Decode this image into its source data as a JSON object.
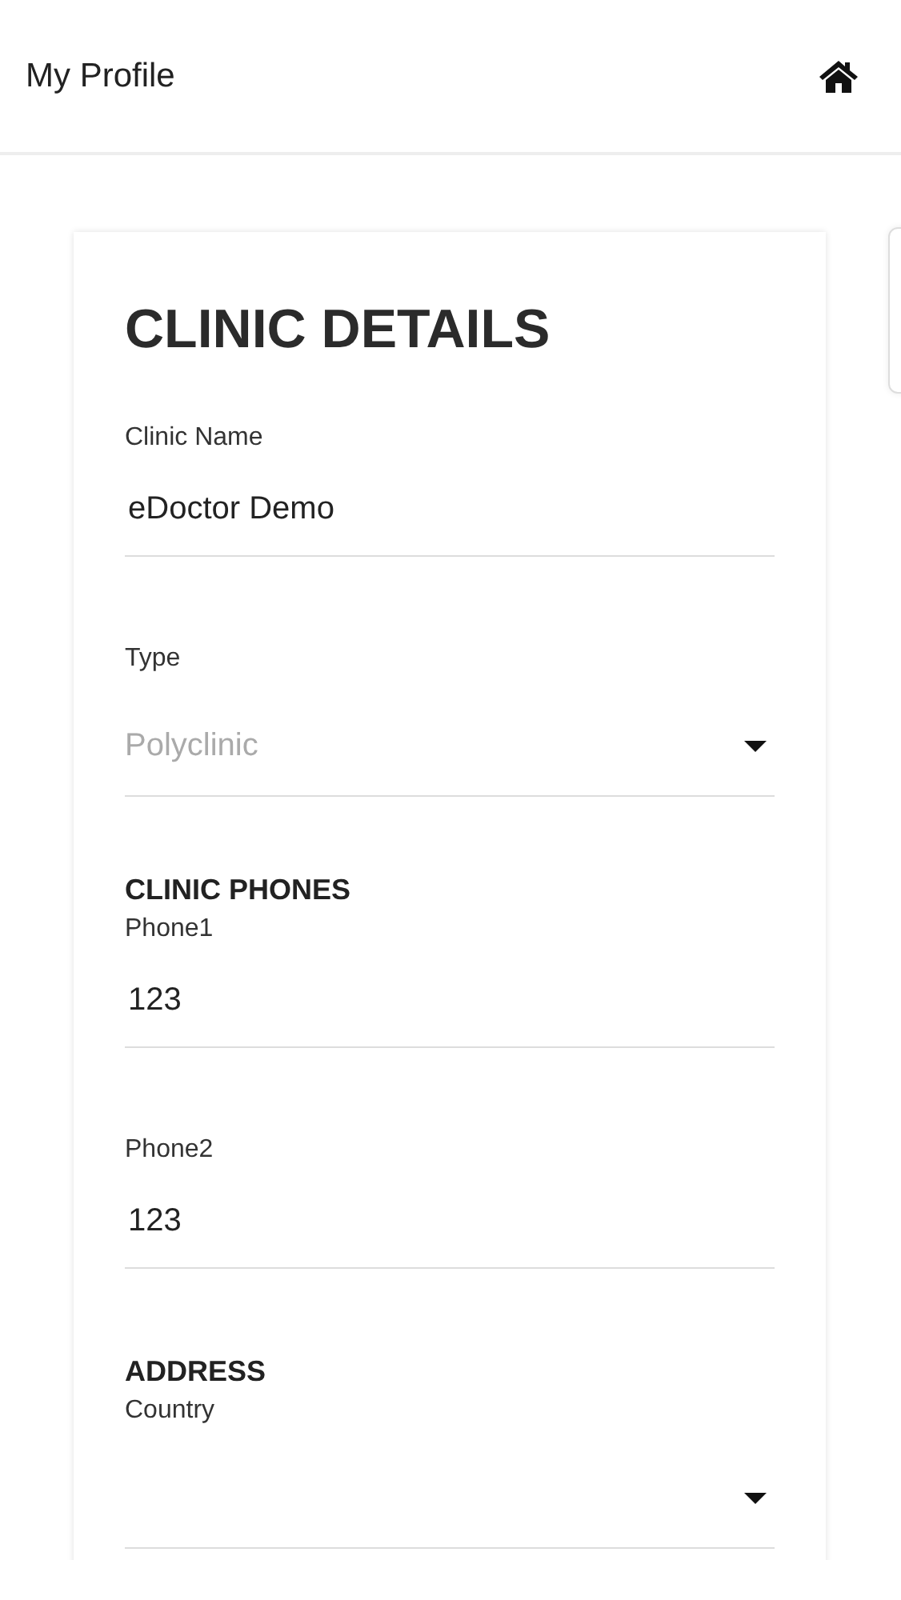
{
  "header": {
    "title": "My Profile"
  },
  "card": {
    "title": "CLINIC DETAILS",
    "items": [
      {
        "kind": "field",
        "label": "Clinic Name",
        "value": "eDoctor Demo"
      },
      {
        "kind": "select",
        "label": "Type",
        "placeholder": "Polyclinic"
      },
      {
        "kind": "section",
        "title": "CLINIC PHONES"
      },
      {
        "kind": "field",
        "label": "Phone1",
        "value": "123"
      },
      {
        "kind": "field",
        "label": "Phone2",
        "value": "123"
      },
      {
        "kind": "section",
        "title": "ADDRESS"
      },
      {
        "kind": "select",
        "label": "Country"
      }
    ]
  }
}
